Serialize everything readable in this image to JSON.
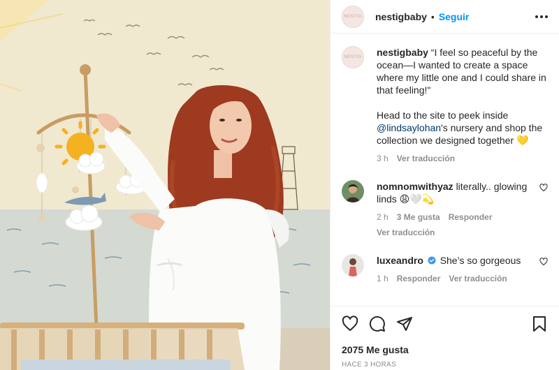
{
  "post": {
    "username": "nestigbaby",
    "follow_label": "Seguir",
    "avatar_text": "NESTIG",
    "caption_username": "nestigbaby",
    "caption_text_1": "“I feel so peaceful by the ocean—I wanted to create a space where my little one and I could share in that feeling!\"",
    "caption_text_2": "Head to the site to peek inside",
    "caption_mention": "@lindsaylohan",
    "caption_text_3": "'s nursery and shop the collection we designed together",
    "caption_emoji": "💛",
    "caption_time": "3 h",
    "caption_translate": "Ver traducción"
  },
  "comments": [
    {
      "username": "nomnomwithyaz",
      "text": "literally.. glowing linds 😩🤍💫",
      "time": "2 h",
      "likes": "3 Me gusta",
      "reply": "Responder",
      "translate": "Ver traducción"
    },
    {
      "username": "luxeandro",
      "text": "She’s so gorgeous",
      "time": "1 h",
      "reply": "Responder",
      "translate": "Ver traducción"
    }
  ],
  "footer": {
    "likes": "2075 Me gusta",
    "ago": "HACE 3 HORAS"
  },
  "colors": {
    "link_blue": "#0095f6",
    "mention_blue": "#00376b",
    "muted": "#8e8e8e",
    "text": "#262626",
    "verified": "#3897f0"
  },
  "icons": [
    "more-icon",
    "heart-icon",
    "comment-icon",
    "share-icon",
    "save-icon",
    "verified-icon"
  ]
}
